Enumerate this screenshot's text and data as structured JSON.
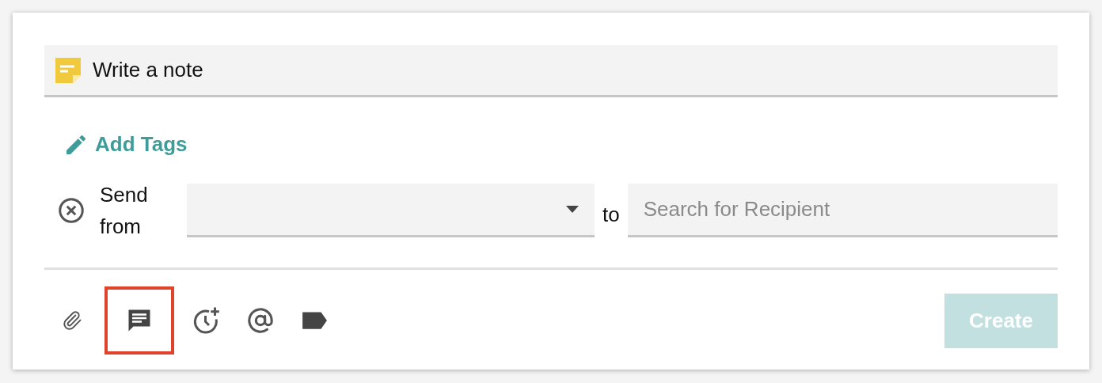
{
  "note": {
    "placeholder": "Write a note"
  },
  "add_tags": {
    "label": "Add Tags"
  },
  "send": {
    "label": "Send from",
    "connector": "to",
    "recipient": {
      "placeholder": "Search for Recipient"
    }
  },
  "toolbar": [
    {
      "kind": "attach",
      "selected": false
    },
    {
      "kind": "comment",
      "selected": true
    },
    {
      "kind": "reminder",
      "selected": false
    },
    {
      "kind": "mention",
      "selected": false
    },
    {
      "kind": "tag",
      "selected": false
    }
  ],
  "create": {
    "label": "Create",
    "disabled": true
  }
}
